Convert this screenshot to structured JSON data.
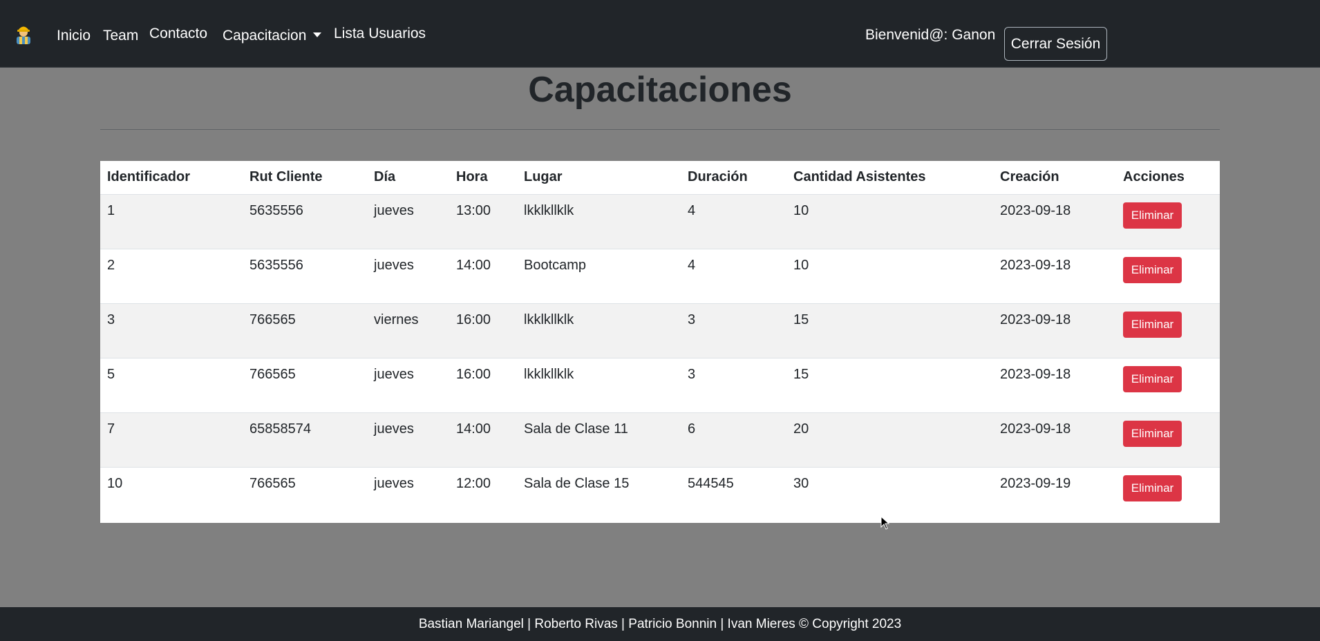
{
  "navbar": {
    "brand_icon": "worker-icon",
    "links": [
      "Inicio",
      "Team",
      "Contacto",
      "Capacitacion",
      "Lista Usuarios"
    ],
    "welcome": "Bienvenid@: Ganon",
    "logout_label": "Cerrar Sesión"
  },
  "main": {
    "title": "Capacitaciones",
    "table": {
      "headers": [
        "Identificador",
        "Rut Cliente",
        "Día",
        "Hora",
        "Lugar",
        "Duración",
        "Cantidad Asistentes",
        "Creación",
        "Acciones"
      ],
      "rows": [
        [
          "1",
          "5635556",
          "jueves",
          "13:00",
          "lkklkllklk",
          "4",
          "10",
          "2023-09-18"
        ],
        [
          "2",
          "5635556",
          "jueves",
          "14:00",
          "Bootcamp",
          "4",
          "10",
          "2023-09-18"
        ],
        [
          "3",
          "766565",
          "viernes",
          "16:00",
          "lkklkllklk",
          "3",
          "15",
          "2023-09-18"
        ],
        [
          "5",
          "766565",
          "jueves",
          "16:00",
          "lkklkllklk",
          "3",
          "15",
          "2023-09-18"
        ],
        [
          "7",
          "65858574",
          "jueves",
          "14:00",
          "Sala de Clase 11",
          "6",
          "20",
          "2023-09-18"
        ],
        [
          "10",
          "766565",
          "jueves",
          "12:00",
          "Sala de Clase 15",
          "544545",
          "30",
          "2023-09-19"
        ]
      ],
      "action_label": "Eliminar"
    }
  },
  "footer": {
    "text": "Bastian Mariangel | Roberto Rivas | Patricio Bonnin | Ivan Mieres © Copyright 2023"
  },
  "colors": {
    "navbar_bg": "#212529",
    "page_bg": "#808080",
    "danger": "#dc3545"
  }
}
